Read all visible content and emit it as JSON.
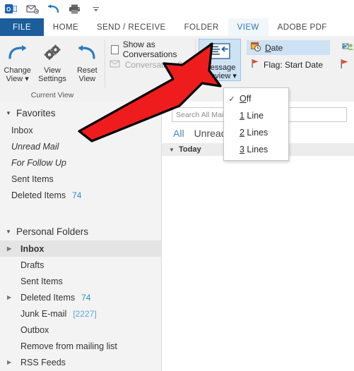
{
  "quick_access": {
    "items": [
      {
        "name": "outlook-logo-icon",
        "label": "Outlook"
      },
      {
        "name": "send-receive-icon",
        "label": "Send/Receive All Folders"
      },
      {
        "name": "undo-icon",
        "label": "Undo"
      },
      {
        "name": "print-icon",
        "label": "Print"
      },
      {
        "name": "customize-qat-icon",
        "label": "Customize Quick Access Toolbar"
      }
    ]
  },
  "ribbon": {
    "tabs": [
      {
        "label": "FILE",
        "active": false
      },
      {
        "label": "HOME",
        "active": false
      },
      {
        "label": "SEND / RECEIVE",
        "active": false
      },
      {
        "label": "FOLDER",
        "active": false
      },
      {
        "label": "VIEW",
        "active": true
      },
      {
        "label": "ADOBE PDF",
        "active": false
      }
    ],
    "current_view_group": {
      "label": "Current View",
      "buttons": [
        {
          "line1": "Change",
          "line2": "View ▾",
          "icon": "change-view-icon"
        },
        {
          "line1": "View",
          "line2": "Settings",
          "icon": "view-settings-icon"
        },
        {
          "line1": "Reset",
          "line2": "View",
          "icon": "reset-view-icon"
        }
      ]
    },
    "messages_group": {
      "label": "M",
      "show_as_conversations": "Show as Conversations",
      "show_as_conversations_checked": false,
      "conversation_settings": "Conversation S",
      "conversation_settings_disabled": true
    },
    "message_preview": {
      "line1": "Message",
      "line2": "Preview ▾",
      "icon": "message-preview-icon",
      "selected": true
    },
    "arrangement": {
      "date_label": "Date",
      "date_mnemonic": "D",
      "date_selected": true,
      "flag_label": "Flag: Start Date",
      "flag_icon": "flag-icon",
      "to_icon": "arrange-by-to-icon",
      "flag_right_icon": "flag-icon"
    }
  },
  "dropdown": {
    "name": "message-preview-menu",
    "items": [
      {
        "label": "Off",
        "mnemonic": "O",
        "rest": "ff",
        "checked": true
      },
      {
        "label": "1 Line",
        "mnemonic": "1",
        "rest": " Line",
        "checked": false
      },
      {
        "label": "2 Lines",
        "mnemonic": "2",
        "rest": " Lines",
        "checked": false
      },
      {
        "label": "3 Lines",
        "mnemonic": "3",
        "rest": " Lines",
        "checked": false
      }
    ]
  },
  "nav_pane": {
    "collapse_icon": "collapse-pane-chevron-icon",
    "favorites": {
      "header": "Favorites",
      "items": [
        {
          "label": "Inbox",
          "count": "",
          "italic": false
        },
        {
          "label": "Unread Mail",
          "count": "",
          "italic": true
        },
        {
          "label": "For Follow Up",
          "count": "",
          "italic": true
        },
        {
          "label": "Sent Items",
          "count": "",
          "italic": false
        },
        {
          "label": "Deleted Items",
          "count": "74",
          "italic": false
        }
      ]
    },
    "personal_folders": {
      "header": "Personal Folders",
      "items": [
        {
          "label": "Inbox",
          "count": "",
          "expandable": true,
          "selected": true
        },
        {
          "label": "Drafts",
          "count": "",
          "expandable": false,
          "selected": false
        },
        {
          "label": "Sent Items",
          "count": "",
          "expandable": false,
          "selected": false
        },
        {
          "label": "Deleted Items",
          "count": "74",
          "expandable": true,
          "selected": false
        },
        {
          "label": "Junk E-mail",
          "count": "[2227]",
          "expandable": false,
          "selected": false
        },
        {
          "label": "Outbox",
          "count": "",
          "expandable": false,
          "selected": false
        },
        {
          "label": "Remove from mailing list",
          "count": "",
          "expandable": false,
          "selected": false
        },
        {
          "label": "RSS Feeds",
          "count": "",
          "expandable": true,
          "selected": false
        }
      ]
    }
  },
  "message_list": {
    "search_placeholder": "Search All Mail Items",
    "filters": [
      {
        "label": "All",
        "active": true
      },
      {
        "label": "Unread",
        "active": false
      }
    ],
    "group_header": "Today"
  },
  "annotation": {
    "name": "red-arrow-annotation",
    "color": "#ee1c1c",
    "outline": "#000000"
  }
}
